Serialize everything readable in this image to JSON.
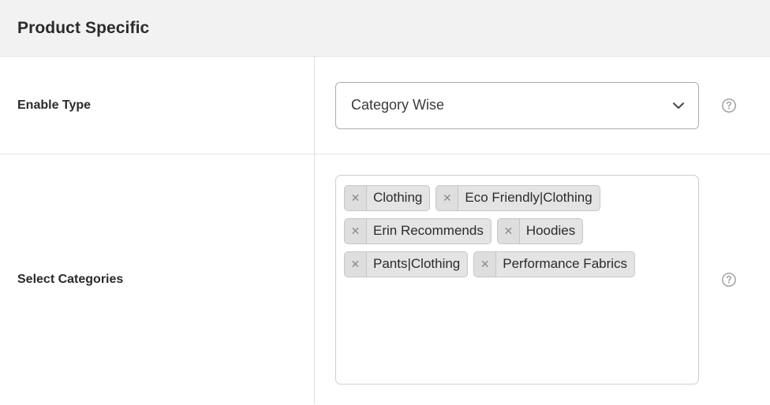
{
  "section": {
    "title": "Product Specific"
  },
  "fields": [
    {
      "label": "Enable Type",
      "control": "select",
      "value": "Category Wise",
      "dropdown_icon": "chevron-down-icon",
      "help_icon": "help-circle-icon"
    },
    {
      "label": "Select Categories",
      "control": "multiselect",
      "help_icon": "help-circle-icon",
      "tags": [
        {
          "label": "Clothing",
          "remove_icon": "close-icon"
        },
        {
          "label": "Eco Friendly|Clothing",
          "remove_icon": "close-icon"
        },
        {
          "label": "Erin Recommends",
          "remove_icon": "close-icon"
        },
        {
          "label": "Hoodies",
          "remove_icon": "close-icon"
        },
        {
          "label": "Pants|Clothing",
          "remove_icon": "close-icon"
        },
        {
          "label": "Performance Fabrics",
          "remove_icon": "close-icon"
        }
      ]
    }
  ],
  "colors": {
    "header_bg": "#f2f2f2",
    "text": "#2b2b2b",
    "tag_bg": "#e4e4e4",
    "tag_border": "#c6c6c6",
    "divider": "#e0e0e0",
    "icon_gray": "#9b9b9b"
  }
}
